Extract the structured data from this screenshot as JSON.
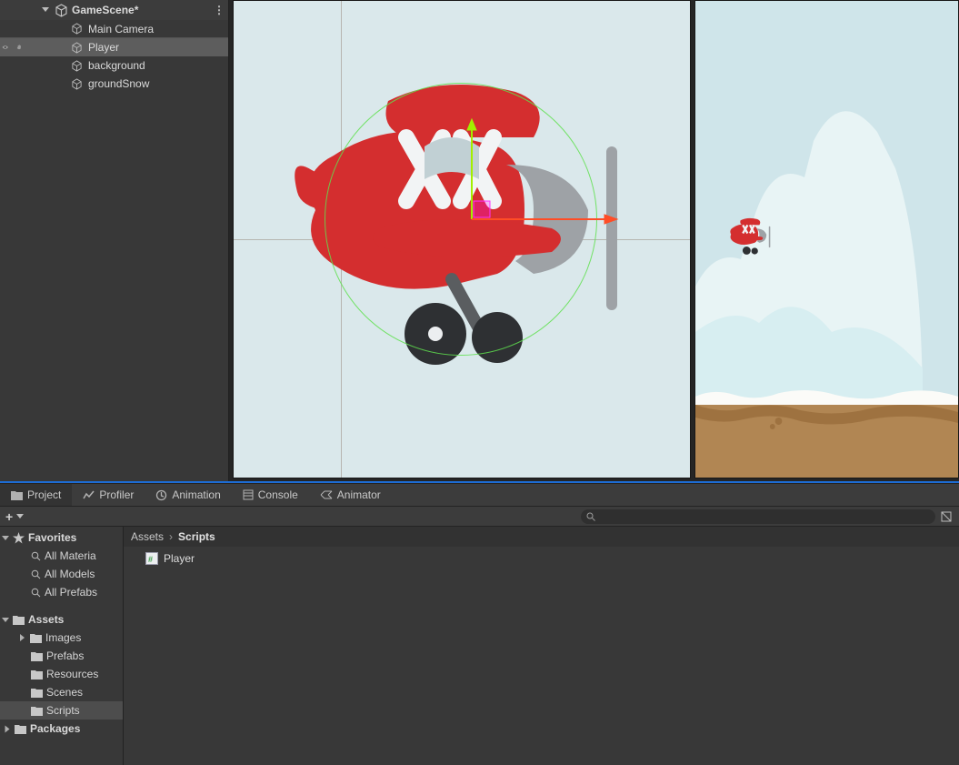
{
  "hierarchy": {
    "scene_name": "GameScene*",
    "items": [
      {
        "label": "Main Camera",
        "sel": false
      },
      {
        "label": "Player",
        "sel": true
      },
      {
        "label": "background",
        "sel": false
      },
      {
        "label": "groundSnow",
        "sel": false
      }
    ]
  },
  "bottom_tabs": [
    {
      "label": "Project",
      "icon": "folder",
      "active": true
    },
    {
      "label": "Profiler",
      "icon": "profiler",
      "active": false
    },
    {
      "label": "Animation",
      "icon": "clock",
      "active": false
    },
    {
      "label": "Console",
      "icon": "console",
      "active": false
    },
    {
      "label": "Animator",
      "icon": "animator",
      "active": false
    }
  ],
  "search": {
    "placeholder": ""
  },
  "folders": {
    "favorites_label": "Favorites",
    "favorites": [
      {
        "label": "All Materia"
      },
      {
        "label": "All Models"
      },
      {
        "label": "All Prefabs"
      }
    ],
    "assets_label": "Assets",
    "assets": [
      {
        "label": "Images",
        "expandable": true
      },
      {
        "label": "Prefabs",
        "expandable": false
      },
      {
        "label": "Resources",
        "expandable": false
      },
      {
        "label": "Scenes",
        "expandable": false
      },
      {
        "label": "Scripts",
        "expandable": false,
        "sel": true
      }
    ],
    "packages_label": "Packages"
  },
  "breadcrumb": {
    "root": "Assets",
    "current": "Scripts"
  },
  "files": [
    {
      "label": "Player",
      "kind": "csharp"
    }
  ]
}
